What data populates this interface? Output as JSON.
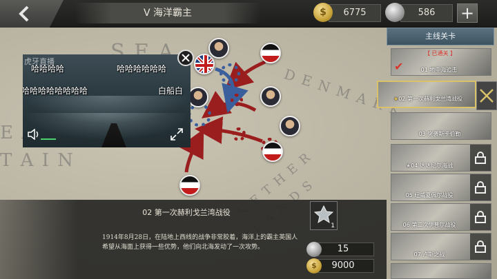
{
  "header": {
    "back_icon": "back-chevron-icon",
    "title": "V 海洋霸主",
    "gold": "6775",
    "silver": "586",
    "plus_icon": "plus-icon"
  },
  "map": {
    "labels": [
      "S E A",
      "D E N M A R K",
      "N E T H E R",
      "L A N D S",
      "E A",
      "T A I N"
    ]
  },
  "video": {
    "logo": "虎牙直播",
    "danmaku": [
      "哈哈哈哈",
      "哈哈哈哈哈哈",
      "哈哈哈哈哈哈哈哈",
      "白船白"
    ],
    "volume_icon": "speaker-icon",
    "fullscreen_icon": "fullscreen-icon",
    "close_icon": "close-icon"
  },
  "battle": {
    "title": "02 第一次赫利戈兰湾战役",
    "description": "1914年8月28日，在陆地上西线的战争非常胶着，海洋上的霸主英国人希望从海面上获得一些优势，他们向北海发动了一次攻势。",
    "medal_count": "1",
    "rewards": {
      "silver": "15",
      "gold": "9000"
    }
  },
  "campaign": {
    "header": "主线关卡",
    "passed_label": "【 已通关 】",
    "missions": [
      {
        "label": "01 地中海追击",
        "state": "passed"
      },
      {
        "label": "02 第一次赫利戈兰湾战役",
        "state": "selected"
      },
      {
        "label": "03 突袭斯卡伯勒",
        "state": "open"
      },
      {
        "label": "04 达达尼尔海战",
        "state": "locked"
      },
      {
        "label": "05 纽威夏佩尔战役",
        "state": "locked"
      },
      {
        "label": "06 第二次伊普尔战役",
        "state": "locked"
      },
      {
        "label": "07 卢斯之战",
        "state": "locked"
      }
    ]
  }
}
